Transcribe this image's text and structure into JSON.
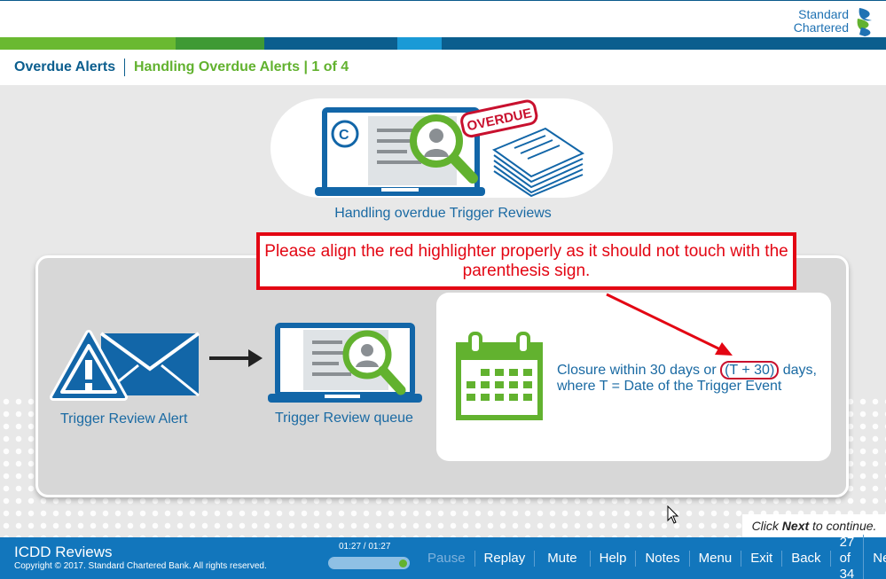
{
  "colors": {
    "brand_blue": "#1276bc",
    "brand_green": "#62b22f",
    "alert_red": "#e30613"
  },
  "logo": {
    "line1": "Standard",
    "line2": "Chartered"
  },
  "breadcrumb": {
    "module": "Overdue Alerts",
    "topic": "Handling Overdue Alerts | 1 of 4"
  },
  "slide": {
    "hero_badge": "OVERDUE",
    "hero_caption": "Handling overdue Trigger Reviews",
    "review_note": "Please align the red highlighter properly as it should not touch with the parenthesis sign.",
    "step1_label": "Trigger Review Alert",
    "step2_label": "Trigger Review queue",
    "closure_before": "Closure within 30 days or ",
    "closure_highlight": "(T + 30)",
    "closure_after": " days,",
    "closure_line2": "where T = Date of the Trigger Event",
    "continue_pre": "Click ",
    "continue_bold": "Next",
    "continue_post": " to continue.",
    "icons": [
      "laptop-icon",
      "magnifier-icon",
      "document-stack-icon",
      "warning-icon",
      "envelope-icon",
      "arrow-right-icon",
      "calendar-icon"
    ]
  },
  "footer": {
    "course_title": "ICDD Reviews",
    "copyright": "Copyright © 2017. Standard Chartered Bank. All rights reserved.",
    "time": "01:27 / 01:27",
    "progress": 1.0,
    "buttons": {
      "pause": "Pause",
      "replay": "Replay",
      "mute": "Mute",
      "help": "Help",
      "notes": "Notes",
      "menu": "Menu",
      "exit": "Exit",
      "back": "Back",
      "next": "Next"
    },
    "page_count": "27 of 34"
  }
}
